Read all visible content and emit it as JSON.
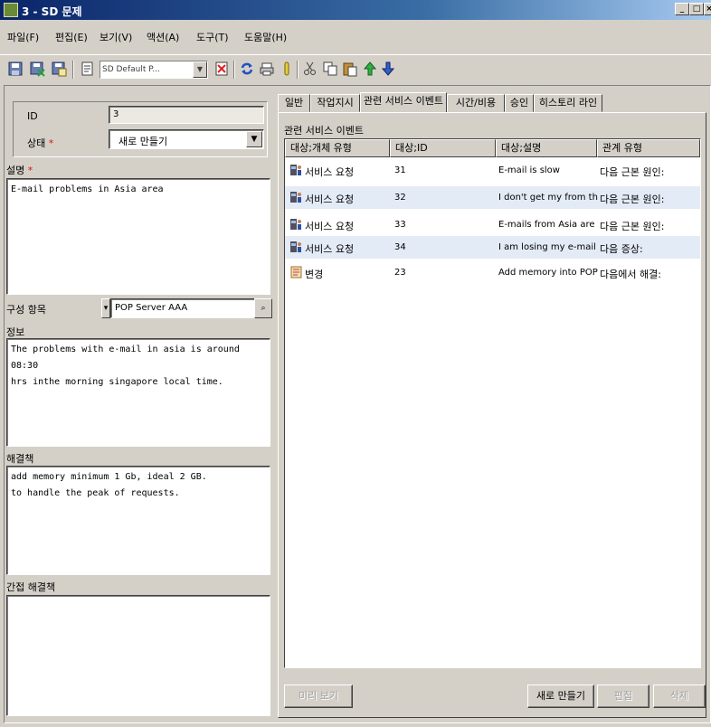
{
  "window": {
    "title": "3 - SD 문제",
    "min": "_",
    "max": "□",
    "close": "×"
  },
  "menu": [
    "파일(F)",
    "편집(E)",
    "보기(V)",
    "액션(A)",
    "도구(T)",
    "도움말(H)"
  ],
  "toolbar": {
    "template_combo": "SD Default P..."
  },
  "form": {
    "id_label": "ID",
    "id_value": "3",
    "status_label": "상태",
    "status_value": "새로 만들기",
    "required_mark": "*",
    "description_label": "설명",
    "description_value": "E-mail problems in Asia area",
    "config_item_label": "구성 항목",
    "config_item_value": "POP Server AAA",
    "info_label": "정보",
    "info_value": "The problems with e-mail in asia is around 08:30\nhrs inthe morning singapore local time.",
    "solution_label": "해결책",
    "solution_value": "add memory minimum 1 Gb, ideal 2 GB.\nto handle the peak of requests.",
    "workaround_label": "간접 해결책",
    "workaround_value": ""
  },
  "tabs": [
    "일반",
    "작업지시",
    "관련 서비스 이벤트",
    "시간/비용",
    "승인",
    "히스토리 라인"
  ],
  "active_tab": "관련 서비스 이벤트",
  "section_title": "관련 서비스 이벤트",
  "table": {
    "columns": [
      "대상;개체 유형",
      "대상;ID",
      "대상;설명",
      "관계 유형"
    ],
    "rows": [
      {
        "type": "서비스 요청",
        "id": "31",
        "desc": "E-mail is slow",
        "relation": "다음 근본 원인:",
        "icon": "service-call-icon"
      },
      {
        "type": "서비스 요청",
        "id": "32",
        "desc": "I don't get my from the m..",
        "relation": "다음 근본 원인:",
        "icon": "service-call-icon"
      },
      {
        "type": "서비스 요청",
        "id": "33",
        "desc": "E-mails from Asia are ve..",
        "relation": "다음 근본 원인:",
        "icon": "service-call-icon"
      },
      {
        "type": "서비스 요청",
        "id": "34",
        "desc": "I am losing my e-mail con..",
        "relation": "다음 증상:",
        "icon": "service-call-icon"
      },
      {
        "type": "변경",
        "id": "23",
        "desc": "Add memory into POP se..",
        "relation": "다음에서 해결:",
        "icon": "change-icon"
      }
    ]
  },
  "buttons": {
    "preview": "미리 보기",
    "new": "새로 만들기",
    "edit": "편집",
    "delete": "삭제"
  }
}
